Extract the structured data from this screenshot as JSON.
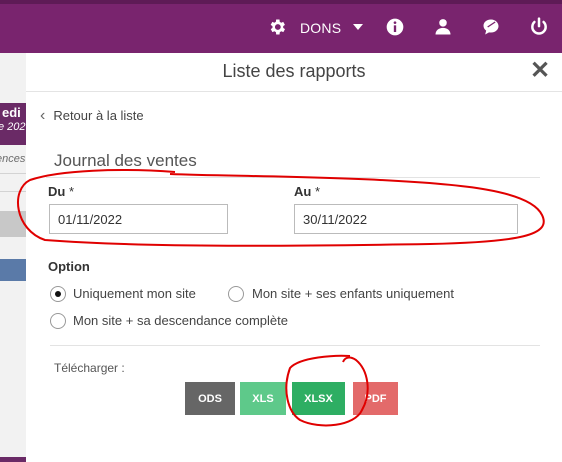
{
  "topbar": {
    "dons_label": "DONS",
    "icons": [
      "gear-icon",
      "caret-down-icon",
      "info-icon",
      "user-icon",
      "chat-icon",
      "power-icon"
    ],
    "color": "#79246e"
  },
  "background": {
    "day_label": "edi",
    "date_fragment": "e 202",
    "text_fragment": "ences"
  },
  "modal": {
    "title": "Liste des rapports",
    "back_label": "Retour à la liste",
    "section_title": "Journal des ventes",
    "from_label": "Du",
    "from_value": "01/11/2022",
    "to_label": "Au",
    "to_value": "30/11/2022",
    "required_mark": "*",
    "option_title": "Option",
    "options": [
      {
        "label": "Uniquement mon site",
        "selected": true
      },
      {
        "label": "Mon site + ses enfants uniquement",
        "selected": false
      },
      {
        "label": "Mon site + sa descendance complète",
        "selected": false
      }
    ],
    "download_label": "Télécharger :",
    "buttons": [
      {
        "label": "ODS",
        "color": "#666666"
      },
      {
        "label": "XLS",
        "color": "#5ec98a"
      },
      {
        "label": "XLSX",
        "color": "#2eae63"
      },
      {
        "label": "PDF",
        "color": "#e36a6a"
      }
    ]
  },
  "annotation_color": "#e00000"
}
